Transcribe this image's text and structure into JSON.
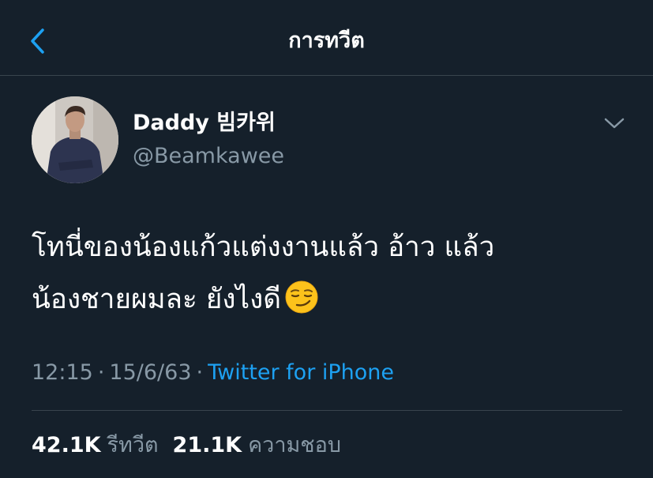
{
  "header": {
    "title": "การทวีต",
    "back_icon": "chevron-left-icon"
  },
  "tweet": {
    "author": {
      "display_name": "Daddy 빔카위",
      "handle": "@Beamkawee"
    },
    "text_line_1": "โทนี่ของน้องแก้วแต่งงานแล้ว อ้าว แล้ว",
    "text_line_2": "น้องชายผมละ ยังไงดี",
    "emoji": "smirking-face-emoji",
    "time": "12:15",
    "date": "15/6/63",
    "separator": "·",
    "source": "Twitter for iPhone"
  },
  "stats": {
    "retweets_count": "42.1K",
    "retweets_label": "รีทวีต",
    "likes_count": "21.1K",
    "likes_label": "ความชอบ"
  },
  "colors": {
    "background": "#15202b",
    "divider": "#38444d",
    "accent": "#1da1f2",
    "secondary_text": "#8899a6"
  }
}
